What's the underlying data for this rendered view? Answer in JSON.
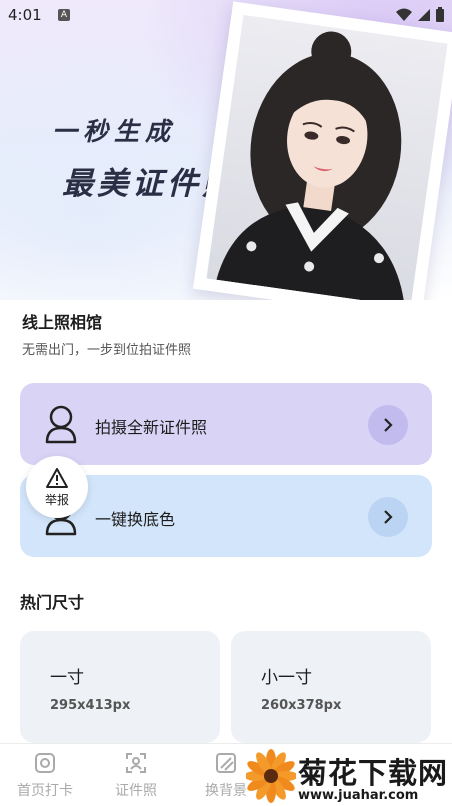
{
  "status_bar": {
    "time": "4:01",
    "notification_badge": "A"
  },
  "hero": {
    "slogan_line1": "一秒生成",
    "slogan_line2": "最美证件照"
  },
  "studio": {
    "title": "线上照相馆",
    "subtitle": "无需出门，一步到位拍证件照"
  },
  "actions": [
    {
      "label": "拍摄全新证件照",
      "icon": "person-outline-icon"
    },
    {
      "label": "一键换底色",
      "icon": "person-outline-icon"
    }
  ],
  "report": {
    "label": "举报",
    "icon": "warning-icon"
  },
  "hot_sizes": {
    "title": "热门尺寸",
    "items": [
      {
        "name": "一寸",
        "dimensions": "295x413px"
      },
      {
        "name": "小一寸",
        "dimensions": "260x378px"
      }
    ]
  },
  "bottom_nav": [
    {
      "label": "首页打卡",
      "icon": "camera-square-icon"
    },
    {
      "label": "证件照",
      "icon": "portrait-scan-icon"
    },
    {
      "label": "换背景",
      "icon": "background-slash-icon"
    }
  ],
  "watermark": {
    "text": "菊花下载网",
    "url": "www.juahar.com"
  },
  "colors": {
    "card_purple": "#d9d4f6",
    "card_blue": "#d3e5fb",
    "size_card_bg": "#eef1f6",
    "nav_inactive": "#aaaaaa"
  }
}
